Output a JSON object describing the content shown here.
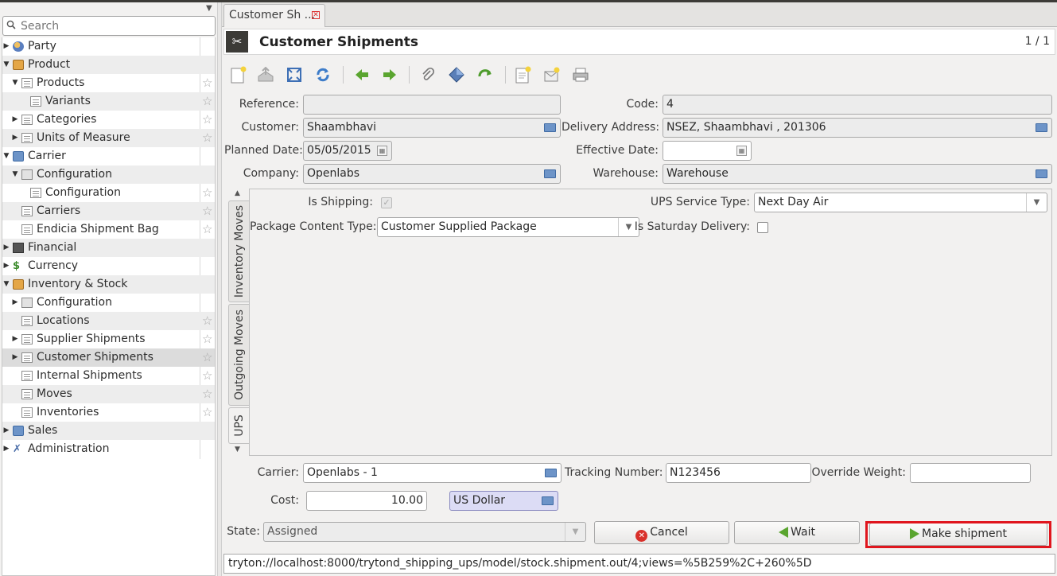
{
  "sidebar": {
    "search_placeholder": "Search",
    "items": [
      {
        "label": "Party",
        "icon": "party-icon",
        "expander": "▶",
        "level": 0,
        "star": false
      },
      {
        "label": "Product",
        "icon": "box-icon",
        "expander": "▼",
        "level": 0,
        "star": false
      },
      {
        "label": "Products",
        "icon": "document-icon",
        "expander": "▼",
        "level": 1,
        "star": true
      },
      {
        "label": "Variants",
        "icon": "document-icon",
        "expander": "",
        "level": 2,
        "star": true
      },
      {
        "label": "Categories",
        "icon": "document-icon",
        "expander": "▶",
        "level": 1,
        "star": true
      },
      {
        "label": "Units of Measure",
        "icon": "document-icon",
        "expander": "▶",
        "level": 1,
        "star": true
      },
      {
        "label": "Carrier",
        "icon": "folder-icon",
        "expander": "▼",
        "level": 0,
        "star": false
      },
      {
        "label": "Configuration",
        "icon": "configuration-icon",
        "expander": "▼",
        "level": 1,
        "star": false
      },
      {
        "label": "Configuration",
        "icon": "document-icon",
        "expander": "",
        "level": 2,
        "star": true
      },
      {
        "label": "Carriers",
        "icon": "document-icon",
        "expander": "",
        "level": 1,
        "star": true
      },
      {
        "label": "Endicia Shipment Bag",
        "icon": "document-icon",
        "expander": "",
        "level": 1,
        "star": true
      },
      {
        "label": "Financial",
        "icon": "calculator-icon",
        "expander": "▶",
        "level": 0,
        "star": false
      },
      {
        "label": "Currency",
        "icon": "money-icon",
        "expander": "▶",
        "level": 0,
        "star": false
      },
      {
        "label": "Inventory & Stock",
        "icon": "box-icon",
        "expander": "▼",
        "level": 0,
        "star": false
      },
      {
        "label": "Configuration",
        "icon": "configuration-icon",
        "expander": "▶",
        "level": 1,
        "star": false
      },
      {
        "label": "Locations",
        "icon": "document-icon",
        "expander": "",
        "level": 1,
        "star": true
      },
      {
        "label": "Supplier Shipments",
        "icon": "document-icon",
        "expander": "▶",
        "level": 1,
        "star": true
      },
      {
        "label": "Customer Shipments",
        "icon": "document-icon",
        "expander": "▶",
        "level": 1,
        "star": true,
        "selected": true
      },
      {
        "label": "Internal Shipments",
        "icon": "document-icon",
        "expander": "",
        "level": 1,
        "star": true
      },
      {
        "label": "Moves",
        "icon": "document-icon",
        "expander": "",
        "level": 1,
        "star": true
      },
      {
        "label": "Inventories",
        "icon": "document-icon",
        "expander": "",
        "level": 1,
        "star": true
      },
      {
        "label": "Sales",
        "icon": "folder-icon",
        "expander": "▶",
        "level": 0,
        "star": false
      },
      {
        "label": "Administration",
        "icon": "tools-icon",
        "expander": "▶",
        "level": 0,
        "star": false
      }
    ]
  },
  "tab": {
    "label": "Customer Sh ..."
  },
  "header": {
    "title": "Customer Shipments",
    "record_count": "1 / 1"
  },
  "form": {
    "reference": {
      "label": "Reference:",
      "value": ""
    },
    "code": {
      "label": "Code:",
      "value": "4"
    },
    "customer": {
      "label": "Customer:",
      "value": "Shaambhavi"
    },
    "delivery_address": {
      "label": "Delivery Address:",
      "value": "NSEZ, Shaambhavi , 201306"
    },
    "planned_date": {
      "label": "Planned Date:",
      "value": "05/05/2015"
    },
    "effective_date": {
      "label": "Effective Date:",
      "value": ""
    },
    "company": {
      "label": "Company:",
      "value": "Openlabs"
    },
    "warehouse": {
      "label": "Warehouse:",
      "value": "Warehouse"
    }
  },
  "notebook": {
    "tabs": [
      "Inventory Moves",
      "Outgoing Moves",
      "UPS"
    ],
    "active_tab": "UPS",
    "ups": {
      "is_shipping": {
        "label": "Is Shipping:",
        "checked": true
      },
      "service_type": {
        "label": "UPS Service Type:",
        "value": "Next Day Air"
      },
      "package_content_type": {
        "label": "Package Content Type:",
        "value": "Customer Supplied Package"
      },
      "saturday_delivery": {
        "label": "Is Saturday Delivery:",
        "checked": false
      }
    }
  },
  "shipping": {
    "carrier": {
      "label": "Carrier:",
      "value": "Openlabs - 1"
    },
    "tracking_number": {
      "label": "Tracking Number:",
      "value": "N123456"
    },
    "override_weight": {
      "label": "Override Weight:",
      "value": ""
    },
    "cost": {
      "label": "Cost:",
      "value": "10.00"
    },
    "currency": {
      "value": "US Dollar"
    }
  },
  "footer": {
    "state_label": "State:",
    "state_value": "Assigned",
    "cancel_label": "Cancel",
    "wait_label": "Wait",
    "make_shipment_label": "Make shipment"
  },
  "status_url": "tryton://localhost:8000/trytond_shipping_ups/model/stock.shipment.out/4;views=%5B259%2C+260%5D",
  "colors": {
    "highlight": "#e0161e",
    "accent_green": "#5aa52f",
    "folder_blue": "#6d94c8"
  }
}
